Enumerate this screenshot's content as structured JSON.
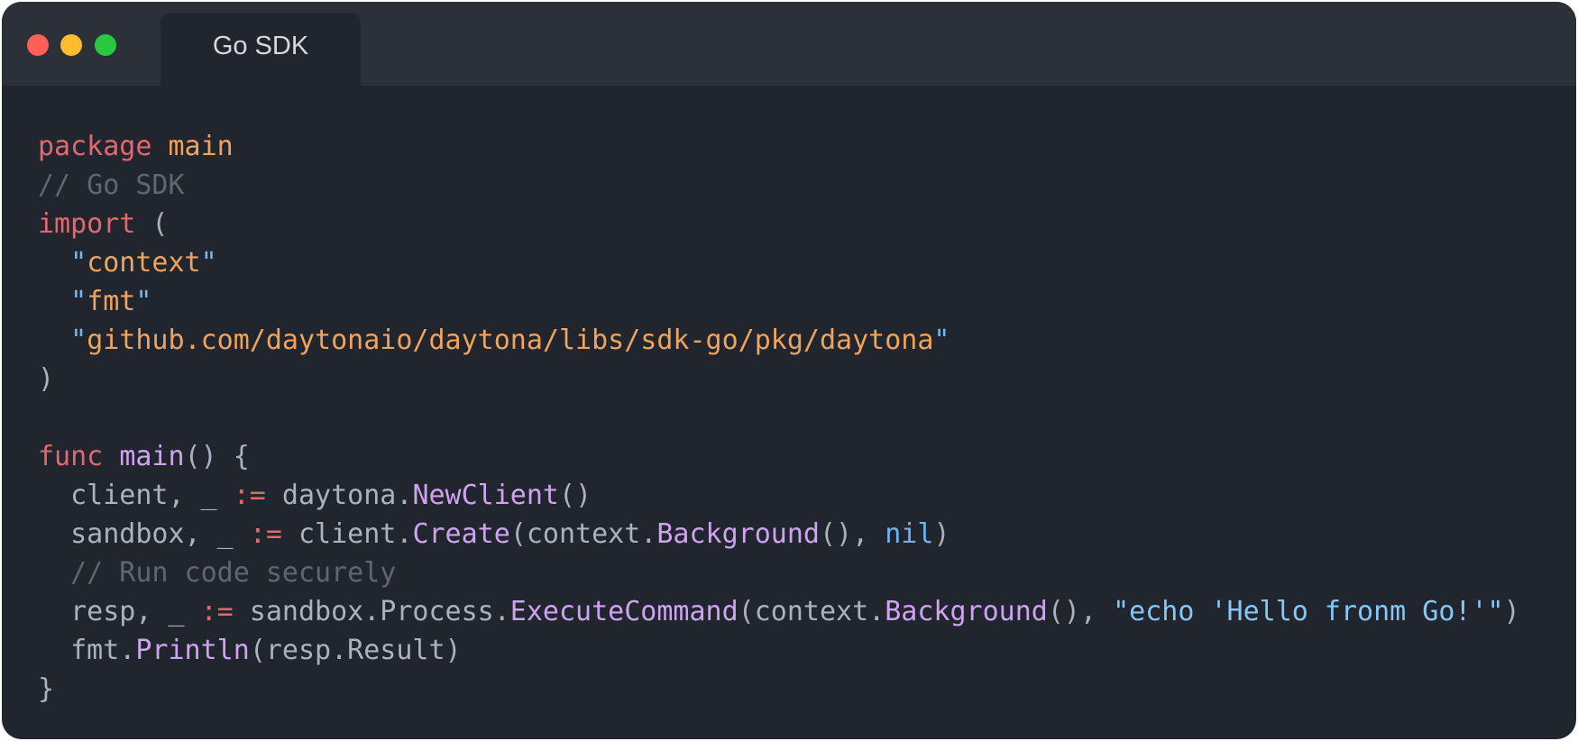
{
  "window": {
    "tab_label": "Go SDK",
    "controls": [
      "close",
      "minimize",
      "maximize"
    ]
  },
  "colors": {
    "background": "#21252d",
    "titlebar": "#2c3039",
    "keyword": "#e5676e",
    "string": "#f0a35e",
    "comment": "#5f6672",
    "function": "#cfa3f2",
    "literal": "#6fb3f2",
    "text": "#abb2bf"
  },
  "code": {
    "lines": [
      [
        {
          "t": "package",
          "c": "kw"
        },
        {
          "t": " ",
          "c": "plain"
        },
        {
          "t": "main",
          "c": "pkg"
        }
      ],
      [
        {
          "t": "// Go SDK",
          "c": "cm"
        }
      ],
      [
        {
          "t": "import",
          "c": "kw"
        },
        {
          "t": " (",
          "c": "plain"
        }
      ],
      [
        {
          "t": "  ",
          "c": "plain"
        },
        {
          "t": "\"",
          "c": "q"
        },
        {
          "t": "context",
          "c": "str"
        },
        {
          "t": "\"",
          "c": "q"
        }
      ],
      [
        {
          "t": "  ",
          "c": "plain"
        },
        {
          "t": "\"",
          "c": "q"
        },
        {
          "t": "fmt",
          "c": "str"
        },
        {
          "t": "\"",
          "c": "q"
        }
      ],
      [
        {
          "t": "  ",
          "c": "plain"
        },
        {
          "t": "\"",
          "c": "q"
        },
        {
          "t": "github.com/daytonaio/daytona/libs/sdk-go/pkg/daytona",
          "c": "str"
        },
        {
          "t": "\"",
          "c": "q"
        }
      ],
      [
        {
          "t": ")",
          "c": "plain"
        }
      ],
      [],
      [
        {
          "t": "func",
          "c": "kw"
        },
        {
          "t": " ",
          "c": "plain"
        },
        {
          "t": "main",
          "c": "fn"
        },
        {
          "t": "() {",
          "c": "plain"
        }
      ],
      [
        {
          "t": "  client, _ ",
          "c": "plain"
        },
        {
          "t": ":=",
          "c": "op"
        },
        {
          "t": " daytona.",
          "c": "plain"
        },
        {
          "t": "NewClient",
          "c": "fn"
        },
        {
          "t": "()",
          "c": "plain"
        }
      ],
      [
        {
          "t": "  sandbox, _ ",
          "c": "plain"
        },
        {
          "t": ":=",
          "c": "op"
        },
        {
          "t": " client.",
          "c": "plain"
        },
        {
          "t": "Create",
          "c": "fn"
        },
        {
          "t": "(context.",
          "c": "plain"
        },
        {
          "t": "Background",
          "c": "fn"
        },
        {
          "t": "(), ",
          "c": "plain"
        },
        {
          "t": "nil",
          "c": "nil"
        },
        {
          "t": ")",
          "c": "plain"
        }
      ],
      [
        {
          "t": "  // Run code securely",
          "c": "cm"
        }
      ],
      [
        {
          "t": "  resp, _ ",
          "c": "plain"
        },
        {
          "t": ":=",
          "c": "op"
        },
        {
          "t": " sandbox.Process.",
          "c": "plain"
        },
        {
          "t": "ExecuteCommand",
          "c": "fn"
        },
        {
          "t": "(context.",
          "c": "plain"
        },
        {
          "t": "Background",
          "c": "fn"
        },
        {
          "t": "(), ",
          "c": "plain"
        },
        {
          "t": "\"echo 'Hello fronm Go!'\"",
          "c": "bstr"
        },
        {
          "t": ")",
          "c": "plain"
        }
      ],
      [
        {
          "t": "  fmt.",
          "c": "plain"
        },
        {
          "t": "Println",
          "c": "fn"
        },
        {
          "t": "(resp.Result)",
          "c": "plain"
        }
      ],
      [
        {
          "t": "}",
          "c": "plain"
        }
      ]
    ]
  }
}
